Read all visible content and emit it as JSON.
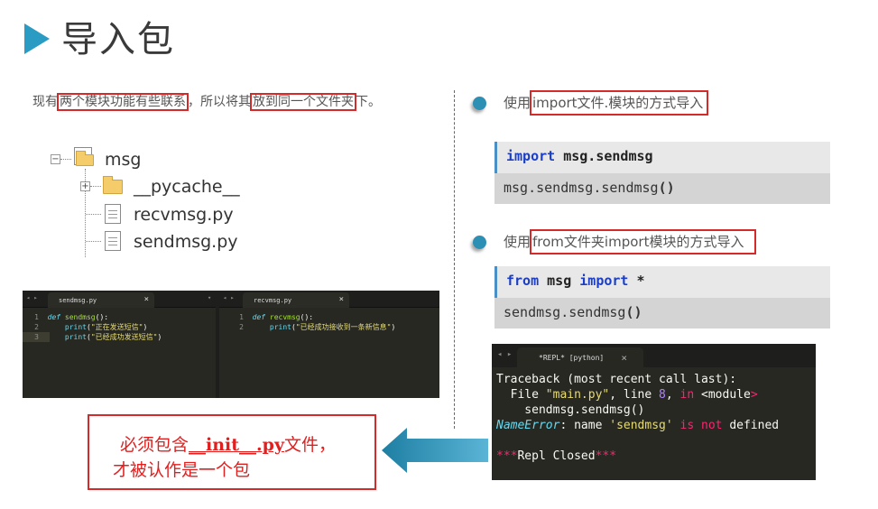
{
  "slide": {
    "title": "导入包"
  },
  "left": {
    "desc": {
      "p1": "现有",
      "h1": "两个模块功能有些联系",
      "p2": "，所以将其",
      "h2": "放到同一个文件夹",
      "p3": "下。"
    },
    "tree": {
      "root": "msg",
      "items": [
        "__pycache__",
        "recvmsg.py",
        "sendmsg.py"
      ]
    },
    "editor": {
      "left_tab": "sendmsg.py",
      "right_tab": "recvmsg.py",
      "left_lines": [
        {
          "n": "1",
          "kw": "def ",
          "fn": "sendmsg",
          "rest": "():"
        },
        {
          "n": "2",
          "pr": "    print",
          "a": "(",
          "st": "\"正在发送短信\"",
          "b": ")"
        },
        {
          "n": "3",
          "pr": "    print",
          "a": "(",
          "st": "\"已经成功发送短信\"",
          "b": ")"
        }
      ],
      "right_lines": [
        {
          "n": "1",
          "kw": "def ",
          "fn": "recvmsg",
          "rest": "():"
        },
        {
          "n": "2",
          "pr": "    print",
          "a": "(",
          "st": "\"已经成功接收到一条新信息\"",
          "b": ")"
        }
      ],
      "close_glyph": "×",
      "nav_glyph": "◂ ▸",
      "dropdown_glyph": "▾"
    },
    "callout": {
      "l1a": "必须包含",
      "l1b": "__init__.py",
      "l1c": "文件，",
      "l2": "才被认作是一个包"
    }
  },
  "right": {
    "item1": {
      "pre": "使用",
      "boxed": "import文件.模块的方式导入"
    },
    "code1": {
      "kw": "import",
      "mod": " msg.sendmsg",
      "call": "msg.sendmsg.sendmsg",
      "paren": "()"
    },
    "item2": {
      "pre": "使用",
      "boxed": "from文件夹import模块的方式导入"
    },
    "code2": {
      "kw1": "from",
      "mod": " msg ",
      "kw2": "import",
      "star": " *",
      "call": "sendmsg.sendmsg",
      "paren": "()"
    },
    "repl": {
      "tab": "*REPL* [python]",
      "close_glyph": "×",
      "nav_glyph": "◂ ▸",
      "l1": "Traceback (most recent call last):",
      "l2a": "  File ",
      "l2b": "\"main.py\"",
      "l2c": ", line ",
      "l2d": "8",
      "l2e": ", ",
      "l2f": "in",
      "l2g": " <",
      "l2h": "module",
      "l2i": ">",
      "l3": "    sendmsg.sendmsg()",
      "l4a": "NameError",
      "l4b": ": name ",
      "l4c": "'sendmsg'",
      "l4d": " is not",
      "l4e": " defined",
      "l5a": "***",
      "l5b": "Repl Closed",
      "l5c": "***"
    }
  },
  "colors": {
    "accent": "#2a9cc4",
    "highlight_border": "#d52a2a",
    "callout_text": "#e0201f",
    "keyword_blue": "#1a3ec8"
  }
}
